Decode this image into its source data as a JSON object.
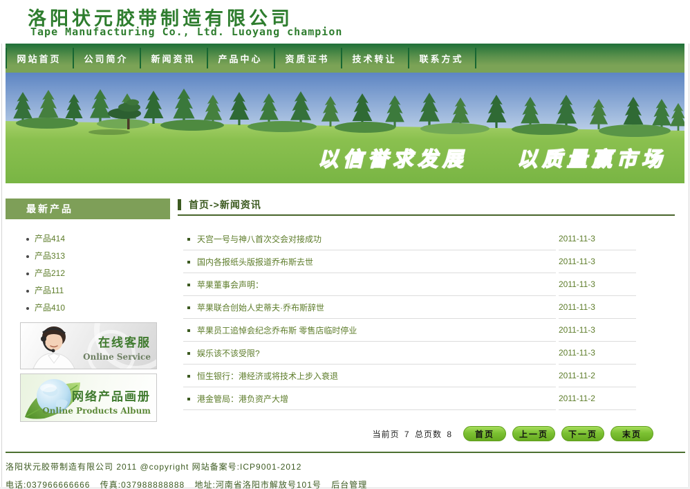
{
  "header": {
    "title": "洛阳状元胶带制造有限公司",
    "subtitle": "Tape Manufacturing Co., Ltd. Luoyang champion"
  },
  "nav": {
    "items": [
      {
        "label": "网站首页"
      },
      {
        "label": "公司简介"
      },
      {
        "label": "新闻资讯"
      },
      {
        "label": "产品中心"
      },
      {
        "label": "资质证书"
      },
      {
        "label": "技术转让"
      },
      {
        "label": "联系方式"
      }
    ]
  },
  "banner": {
    "slogan": "以信誉求发展　　以质量赢市场"
  },
  "sidebar": {
    "title": "最新产品",
    "products": [
      {
        "label": "产品414"
      },
      {
        "label": "产品313"
      },
      {
        "label": "产品212"
      },
      {
        "label": "产品111"
      },
      {
        "label": "产品410"
      }
    ],
    "banners": [
      {
        "title": "在线客服",
        "subtitle": "Online Service"
      },
      {
        "title": "网络产品画册",
        "subtitle": "Online Products Album"
      }
    ]
  },
  "main": {
    "breadcrumb": "首页->新闻资讯",
    "news": [
      {
        "title": "天宫一号与神八首次交会对接成功",
        "date": "2011-11-3"
      },
      {
        "title": "国内各报纸头版报道乔布斯去世",
        "date": "2011-11-3"
      },
      {
        "title": "苹果董事会声明：",
        "date": "2011-11-3"
      },
      {
        "title": "苹果联合创始人史蒂夫·乔布斯辞世",
        "date": "2011-11-3"
      },
      {
        "title": "苹果员工追悼会纪念乔布斯 零售店临时停业",
        "date": "2011-11-3"
      },
      {
        "title": "娱乐该不该受限?",
        "date": "2011-11-3"
      },
      {
        "title": "恒生银行：港经济或将技术上步入衰退",
        "date": "2011-11-2"
      },
      {
        "title": "港金管局：港负资产大增",
        "date": "2011-11-2"
      }
    ],
    "pagination": {
      "current_label": "当前页",
      "current": "7",
      "total_label": "总页数",
      "total": "8",
      "buttons": [
        {
          "label": "首页"
        },
        {
          "label": "上一页"
        },
        {
          "label": "下一页"
        },
        {
          "label": "末页"
        }
      ]
    }
  },
  "footer": {
    "line1": "洛阳状元胶带制造有限公司 2011 @copyright 网站备案号:ICP9001-2012",
    "phone": "电话:037966666666",
    "fax": "传真:037988888888",
    "address": "地址:河南省洛阳市解放号101号",
    "admin": "后台管理"
  },
  "colors": {
    "brand_green": "#2e7d2e",
    "nav_green": "#7ba356",
    "nav_dark_green": "#1f7038",
    "sidebar_header_green": "#7e9f58",
    "link_olive": "#5d7c2a",
    "heading_dark_green": "#3c5a20",
    "button_green": "#7cc133",
    "footer_rule_green": "#4c7030"
  }
}
